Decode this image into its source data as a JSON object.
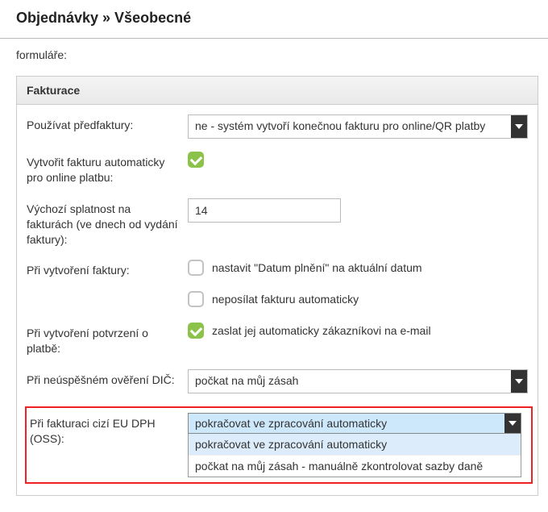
{
  "header": {
    "title": "Objednávky » Všeobecné"
  },
  "stray_label": "formuláře:",
  "panel": {
    "title": "Fakturace"
  },
  "form": {
    "prefaktury": {
      "label": "Používat předfaktury:",
      "value": "ne - systém vytvoří konečnou fakturu pro online/QR platby"
    },
    "auto_online": {
      "label": "Vytvořit fakturu automaticky pro online platbu:"
    },
    "splatnost": {
      "label": "Výchozí splatnost na fakturách (ve dnech od vydání faktury):",
      "value": "14"
    },
    "pri_vytvoreni": {
      "label": "Při vytvoření faktury:",
      "opt1": "nastavit \"Datum plnění\" na aktuální datum",
      "opt2": "neposílat fakturu automaticky"
    },
    "potvrzeni": {
      "label": "Při vytvoření potvrzení o platbě:",
      "opt1": "zaslat jej automaticky zákazníkovi na e-mail"
    },
    "overeni_dic": {
      "label": "Při neúspěšném ověření DIČ:",
      "value": "počkat na můj zásah"
    },
    "oss": {
      "label": "Při fakturaci cizí EU DPH (OSS):",
      "selected": "pokračovat ve zpracování automaticky",
      "options": [
        "pokračovat ve zpracování automaticky",
        "počkat na můj zásah - manuálně zkontrolovat sazby daně"
      ]
    }
  }
}
